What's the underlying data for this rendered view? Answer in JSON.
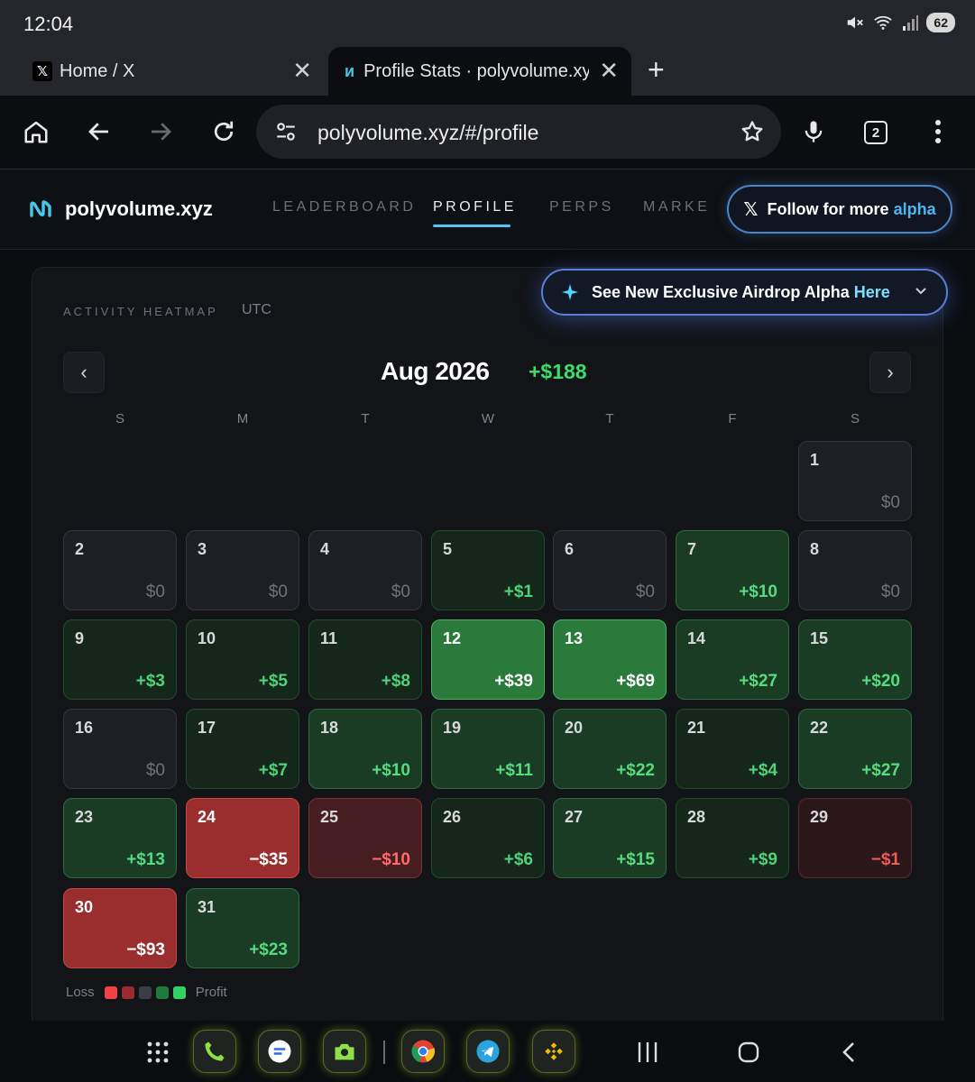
{
  "status": {
    "time": "12:04",
    "battery": "62"
  },
  "tabs": [
    {
      "title": "Home / X",
      "favicon": "x-logo"
    },
    {
      "title": "Profile Stats · polyvolume.xyz",
      "favicon": "polyvolume-logo"
    }
  ],
  "browser": {
    "url": "polyvolume.xyz/#/profile",
    "tab_count": "2"
  },
  "site": {
    "brand": "polyvolume.xyz",
    "nav": [
      "LEADERBOARD",
      "PROFILE",
      "PERPS",
      "MARKET"
    ],
    "follow_prefix": "Follow for more ",
    "follow_accent": "alpha",
    "airdrop_prefix": "See New Exclusive Airdrop Alpha ",
    "airdrop_accent": "Here"
  },
  "heatmap": {
    "label": "ACTIVITY HEATMAP",
    "timezone": "UTC",
    "month": "Aug 2026",
    "total": "+$188",
    "prev": "‹",
    "next": "›",
    "weekdays": [
      "S",
      "M",
      "T",
      "W",
      "T",
      "F",
      "S"
    ],
    "first_weekday": 6,
    "days": [
      {
        "day": "1",
        "value": "$0"
      },
      {
        "day": "2",
        "value": "$0"
      },
      {
        "day": "3",
        "value": "$0"
      },
      {
        "day": "4",
        "value": "$0"
      },
      {
        "day": "5",
        "value": "+$1"
      },
      {
        "day": "6",
        "value": "$0"
      },
      {
        "day": "7",
        "value": "+$10"
      },
      {
        "day": "8",
        "value": "$0"
      },
      {
        "day": "9",
        "value": "+$3"
      },
      {
        "day": "10",
        "value": "+$5"
      },
      {
        "day": "11",
        "value": "+$8"
      },
      {
        "day": "12",
        "value": "+$39"
      },
      {
        "day": "13",
        "value": "+$69"
      },
      {
        "day": "14",
        "value": "+$27"
      },
      {
        "day": "15",
        "value": "+$20"
      },
      {
        "day": "16",
        "value": "$0"
      },
      {
        "day": "17",
        "value": "+$7"
      },
      {
        "day": "18",
        "value": "+$10"
      },
      {
        "day": "19",
        "value": "+$11"
      },
      {
        "day": "20",
        "value": "+$22"
      },
      {
        "day": "21",
        "value": "+$4"
      },
      {
        "day": "22",
        "value": "+$27"
      },
      {
        "day": "23",
        "value": "+$13"
      },
      {
        "day": "24",
        "value": "−$35"
      },
      {
        "day": "25",
        "value": "−$10"
      },
      {
        "day": "26",
        "value": "+$6"
      },
      {
        "day": "27",
        "value": "+$15"
      },
      {
        "day": "28",
        "value": "+$9"
      },
      {
        "day": "29",
        "value": "−$1"
      },
      {
        "day": "30",
        "value": "−$93"
      },
      {
        "day": "31",
        "value": "+$23"
      }
    ],
    "legend": {
      "loss": "Loss",
      "profit": "Profit",
      "colors": [
        "#f04343",
        "#9c2a2e",
        "#3a3d44",
        "#1c7a3a",
        "#35d063"
      ]
    }
  },
  "colors": {
    "accent_blue": "#4fb6f4",
    "profit_green": "#3ddc6b",
    "loss_red": "#ff6b6b"
  }
}
